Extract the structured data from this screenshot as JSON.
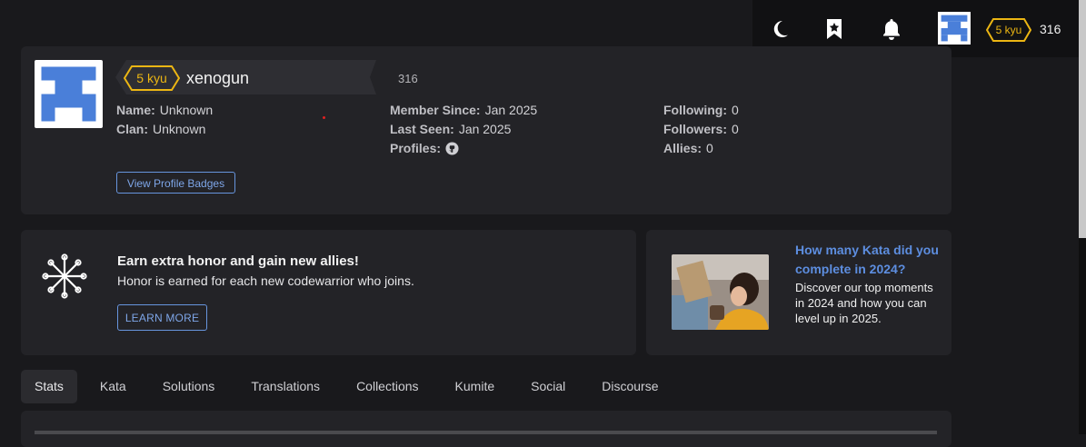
{
  "header": {
    "theme_icon": "moon-icon",
    "bookmark_icon": "bookmark-star-icon",
    "notifications_icon": "bell-icon",
    "rank": "5 kyu",
    "honor": "316"
  },
  "profile": {
    "rank": "5 kyu",
    "username": "xenogun",
    "honor": "316",
    "name_label": "Name:",
    "name_value": "Unknown",
    "clan_label": "Clan:",
    "clan_value": "Unknown",
    "member_since_label": "Member Since:",
    "member_since_value": "Jan 2025",
    "last_seen_label": "Last Seen:",
    "last_seen_value": "Jan 2025",
    "profiles_label": "Profiles:",
    "profiles_icon": "github-icon",
    "following_label": "Following:",
    "following_value": "0",
    "followers_label": "Followers:",
    "followers_value": "0",
    "allies_label": "Allies:",
    "allies_value": "0",
    "badges_button": "View Profile Badges"
  },
  "promo": {
    "icon": "network-burst-icon",
    "title": "Earn extra honor and gain new allies!",
    "subtitle": "Honor is earned for each new codewarrior who joins.",
    "button": "LEARN MORE"
  },
  "news": {
    "title": "How many Kata did you complete in 2024?",
    "body": "Discover our top moments in 2024 and how you can level up in 2025."
  },
  "tabs": [
    {
      "label": "Stats",
      "active": true
    },
    {
      "label": "Kata"
    },
    {
      "label": "Solutions"
    },
    {
      "label": "Translations"
    },
    {
      "label": "Collections"
    },
    {
      "label": "Kumite"
    },
    {
      "label": "Social"
    },
    {
      "label": "Discourse"
    }
  ],
  "colors": {
    "background": "#19191c",
    "panel": "#232327",
    "rank_yellow": "#ecb613",
    "link_blue": "#5d8ee0",
    "avatar_blue": "#4a7fd9"
  }
}
